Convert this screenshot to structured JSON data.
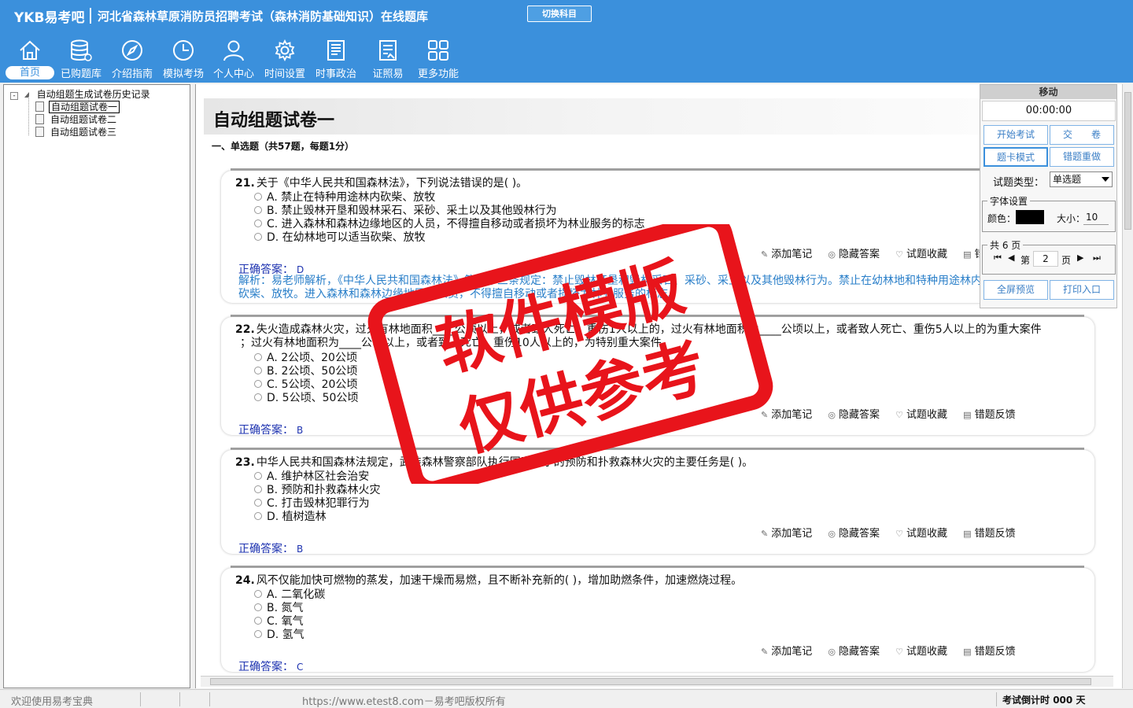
{
  "header": {
    "brand": "YKB易考吧",
    "title": "河北省森林草原消防员招聘考试（森林消防基础知识）在线题库",
    "switch_label": "切换科目"
  },
  "nav": [
    {
      "label": "首页",
      "icon": "home-icon"
    },
    {
      "label": "已购题库",
      "icon": "database-icon"
    },
    {
      "label": "介绍指南",
      "icon": "compass-icon"
    },
    {
      "label": "模拟考场",
      "icon": "clock-icon"
    },
    {
      "label": "个人中心",
      "icon": "user-icon"
    },
    {
      "label": "时间设置",
      "icon": "gear-icon"
    },
    {
      "label": "时事政治",
      "icon": "news-icon"
    },
    {
      "label": "证照易",
      "icon": "document-icon"
    },
    {
      "label": "更多功能",
      "icon": "grid-icon"
    }
  ],
  "tree": {
    "root": "自动组题生成试卷历史记录",
    "root_toggle": "-",
    "items": [
      "自动组题试卷一",
      "自动组题试卷二",
      "自动组题试卷三"
    ]
  },
  "paper": {
    "title": "自动组题试卷一",
    "section": "一、单选题（共57题，每题1分）"
  },
  "actions": {
    "note": "添加笔记",
    "hide": "隐藏答案",
    "fav": "试题收藏",
    "report": "错题反馈"
  },
  "answer_label": "正确答案：",
  "questions": [
    {
      "num": "21.",
      "text": "关于《中华人民共和国森林法》，下列说法错误的是( )。",
      "options": [
        "A. 禁止在特种用途林内砍柴、放牧",
        "B. 禁止毁林开垦和毁林采石、采砂、采土以及其他毁林行为",
        "C. 进入森林和森林边缘地区的人员，不得擅自移动或者损坏为林业服务的标志",
        "D. 在幼林地可以适当砍柴、放牧"
      ],
      "answer": "D",
      "analysis": "解析：易老师解析，《中华人民共和国森林法》第二十三条规定：禁止毁林开垦和毁林采石、采砂、采土以及其他毁林行为。禁止在幼林地和特种用途林内砍柴、放牧。进入森林和森林边缘地区的人员，不得擅自移动或者损坏为林业服务的标志。"
    },
    {
      "num": "22.",
      "text": "失火造成森林火灾，过火有林地面积____公顷以上，或者致人死亡、重伤1人以上的，过火有林地面积为____公顷以上，或者致人死亡、重伤5人以上的为重大案件",
      "text2": "；过火有林地面积为____公顷以上，或者致人死亡、重伤10人以上的，为特别重大案件。",
      "options": [
        "A. 2公顷、20公顷",
        "B. 2公顷、50公顷",
        "C. 5公顷、20公顷",
        "D. 5公顷、50公顷"
      ],
      "answer": "B"
    },
    {
      "num": "23.",
      "text": "中华人民共和国森林法规定，武装森林警察部队执行国家赋予的预防和扑救森林火灾的主要任务是( )。",
      "options": [
        "A. 维护林区社会治安",
        "B. 预防和扑救森林火灾",
        "C. 打击毁林犯罪行为",
        "D. 植树造林"
      ],
      "answer": "B"
    },
    {
      "num": "24.",
      "text": "风不仅能加快可燃物的蒸发，加速干燥而易燃，且不断补充新的( )，增加助燃条件，加速燃烧过程。",
      "options": [
        "A. 二氧化碳",
        "B. 氮气",
        "C. 氧气",
        "D. 氢气"
      ],
      "answer": "C"
    }
  ],
  "panel": {
    "move": "移动",
    "timer": "00:00:00",
    "start": "开始考试",
    "submit": "交　　卷",
    "card_mode": "题卡模式",
    "wrong_redo": "错题重做",
    "qtype_label": "试题类型：",
    "qtype_value": "单选题",
    "font_legend": "字体设置",
    "color_label": "颜色：",
    "color_value": "#000000",
    "size_label": "大小：",
    "size_value": "10",
    "pages_legend": "共 6 页",
    "page_prefix": "第",
    "page_value": "2",
    "page_suffix": "页",
    "preview": "全屏预览",
    "print": "打印入口"
  },
  "status": {
    "welcome": "欢迎使用易考宝典",
    "copyright": "https://www.etest8.com－易考吧版权所有",
    "countdown_label": "考试倒计时",
    "countdown_value": "000",
    "countdown_unit": "天"
  },
  "watermark": {
    "line1": "软件模版",
    "line2": "仅供参考"
  }
}
